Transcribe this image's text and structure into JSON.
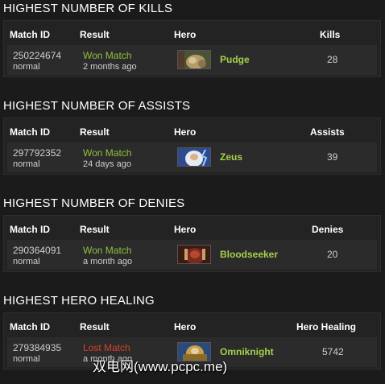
{
  "sections": [
    {
      "title": "HIGHEST NUMBER OF KILLS",
      "headers": {
        "match_id": "Match ID",
        "result": "Result",
        "hero": "Hero",
        "stat": "Kills"
      },
      "row": {
        "match_id": "250224674",
        "mode": "normal",
        "result": "Won Match",
        "result_status": "won",
        "time_ago": "2 months ago",
        "hero": "Pudge",
        "hero_icon": "pudge-portrait",
        "value": "28"
      }
    },
    {
      "title": "HIGHEST NUMBER OF ASSISTS",
      "headers": {
        "match_id": "Match ID",
        "result": "Result",
        "hero": "Hero",
        "stat": "Assists"
      },
      "row": {
        "match_id": "297792352",
        "mode": "normal",
        "result": "Won Match",
        "result_status": "won",
        "time_ago": "24 days ago",
        "hero": "Zeus",
        "hero_icon": "zeus-portrait",
        "value": "39"
      }
    },
    {
      "title": "HIGHEST NUMBER OF DENIES",
      "headers": {
        "match_id": "Match ID",
        "result": "Result",
        "hero": "Hero",
        "stat": "Denies"
      },
      "row": {
        "match_id": "290364091",
        "mode": "normal",
        "result": "Won Match",
        "result_status": "won",
        "time_ago": "a month ago",
        "hero": "Bloodseeker",
        "hero_icon": "bloodseeker-portrait",
        "value": "20"
      }
    },
    {
      "title": "HIGHEST HERO HEALING",
      "headers": {
        "match_id": "Match ID",
        "result": "Result",
        "hero": "Hero",
        "stat": "Hero Healing"
      },
      "row": {
        "match_id": "279384935",
        "mode": "normal",
        "result": "Lost Match",
        "result_status": "lost",
        "time_ago": "a month ago",
        "hero": "Omniknight",
        "hero_icon": "omniknight-portrait",
        "value": "5742"
      }
    }
  ],
  "colors": {
    "background": "#1b1b1b",
    "won": "#8fc13e",
    "lost": "#d6402c",
    "hero_name": "#a6d04a"
  },
  "watermark": "双电网(www.pcpc.me)"
}
